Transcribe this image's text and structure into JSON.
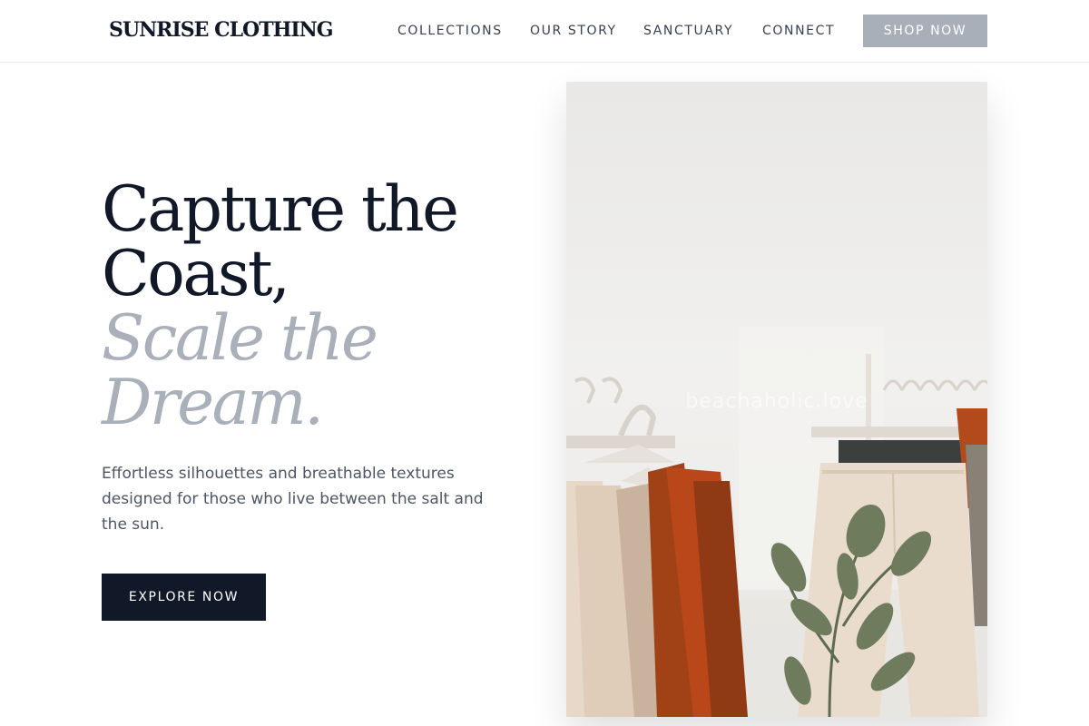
{
  "brand": {
    "name": "SUNRISE CLOTHING"
  },
  "nav": {
    "items": [
      {
        "label": "COLLECTIONS"
      },
      {
        "label": "OUR STORY"
      },
      {
        "label": "SANCTUARY"
      },
      {
        "label": "CONNECT"
      }
    ],
    "cta_label": "SHOP NOW"
  },
  "hero": {
    "title_lines": [
      "Capture the",
      "Coast,",
      "Scale the",
      "Dream."
    ],
    "subtitle": "Effortless silhouettes and breathable textures designed for those who live between the salt and the sun.",
    "cta_label": "EXPLORE NOW",
    "image": {
      "watermark": "beachaholic.love",
      "depicts": "clothing rack with garments on white hangers and a potted plant"
    }
  },
  "colors": {
    "primary_dark": "#111827",
    "muted_title": "#aab0ba",
    "shop_button": "#a8afb9",
    "body_text": "#4b5563"
  }
}
